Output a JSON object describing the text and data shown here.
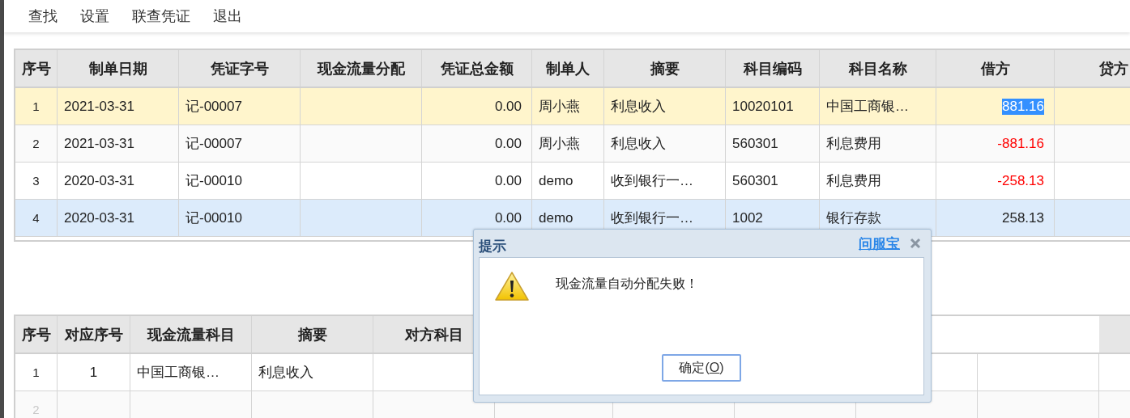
{
  "toolbar": [
    {
      "label": "查找"
    },
    {
      "label": "设置"
    },
    {
      "label": "联查凭证"
    },
    {
      "label": "退出"
    }
  ],
  "voucher_table": {
    "columns": [
      "序号",
      "制单日期",
      "凭证字号",
      "现金流量分配",
      "凭证总金额",
      "制单人",
      "摘要",
      "科目编码",
      "科目名称",
      "借方",
      "贷方"
    ],
    "rows": [
      {
        "cells": [
          "1",
          "2021-03-31",
          "记-00007",
          "",
          "0.00",
          "周小燕",
          "利息收入",
          "10020101",
          "中国工商银…",
          "881.16"
        ],
        "focused": true,
        "selected": false,
        "debit_negative": false,
        "debit_text_selected": true
      },
      {
        "cells": [
          "2",
          "2021-03-31",
          "记-00007",
          "",
          "0.00",
          "周小燕",
          "利息收入",
          "560301",
          "利息费用",
          "-881.16"
        ],
        "focused": false,
        "selected": false,
        "debit_negative": true,
        "debit_text_selected": false
      },
      {
        "cells": [
          "3",
          "2020-03-31",
          "记-00010",
          "",
          "0.00",
          "demo",
          "收到银行一…",
          "560301",
          "利息费用",
          "-258.13"
        ],
        "focused": false,
        "selected": false,
        "debit_negative": true,
        "debit_text_selected": false
      },
      {
        "cells": [
          "4",
          "2020-03-31",
          "记-00010",
          "",
          "0.00",
          "demo",
          "收到银行一…",
          "1002",
          "银行存款",
          "258.13"
        ],
        "focused": false,
        "selected": true,
        "debit_negative": false,
        "debit_text_selected": false
      }
    ]
  },
  "cashflow_table": {
    "columns": [
      "序号",
      "对应序号",
      "现金流量科目",
      "摘要",
      "对方科目"
    ],
    "rows": [
      {
        "cells": [
          "1",
          "1",
          "中国工商银…",
          "利息收入"
        ],
        "disabled": false
      },
      {
        "cells": [
          "2"
        ],
        "disabled": true
      }
    ]
  },
  "dialog": {
    "title": "提示",
    "help_link": "问服宝",
    "message": "现金流量自动分配失败！",
    "button": {
      "before": "确定(",
      "accesskey": "O",
      "after": ")"
    }
  }
}
